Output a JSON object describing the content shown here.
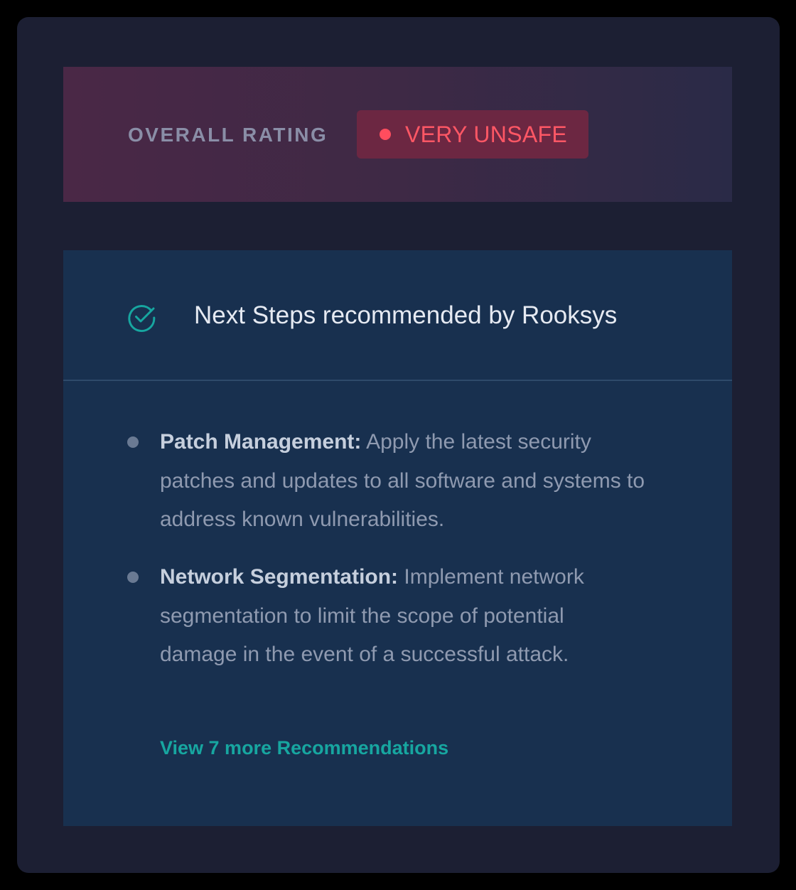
{
  "rating": {
    "label": "OVERALL RATING",
    "status": "VERY UNSAFE",
    "status_color": "#ff5765",
    "status_icon": "dot-icon"
  },
  "next_steps": {
    "icon": "check-circle-icon",
    "title": "Next Steps recommended by Rooksys",
    "recommendations": [
      {
        "title": "Patch Management:",
        "text": "Apply the latest security patches and updates to all software and systems to address known vulnerabilities."
      },
      {
        "title": "Network Segmentation:",
        "text": "Implement network segmentation to limit the scope of potential damage in the event of a successful attack."
      }
    ],
    "view_more_label": "View 7 more Recommendations"
  },
  "colors": {
    "background": "#1c1f33",
    "accent": "#17a6a0",
    "danger": "#ff4d5e",
    "card": "#18304f"
  }
}
